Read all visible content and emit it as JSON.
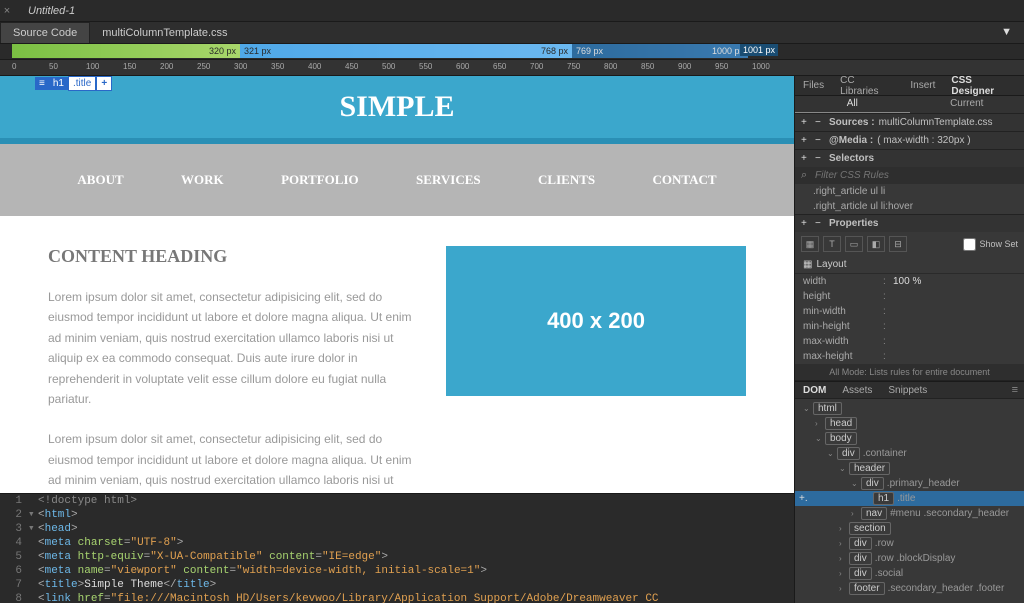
{
  "docTab": "Untitled-1",
  "secondaryTabs": {
    "source": "Source Code",
    "css": "multiColumnTemplate.css"
  },
  "breakpoints": {
    "green": "320  px",
    "blue": {
      "start": "321  px",
      "end": "768  px"
    },
    "darkblue": {
      "start": "769  px",
      "end": "1000  px"
    },
    "scrub": "1001  px"
  },
  "ruler": [
    "0",
    "50",
    "100",
    "150",
    "200",
    "250",
    "300",
    "350",
    "400",
    "450",
    "500",
    "550",
    "600",
    "650",
    "700",
    "750",
    "800",
    "850",
    "900",
    "950",
    "1000"
  ],
  "design": {
    "overlay": {
      "ham": "≡",
      "h1": "h1",
      "title": ".title",
      "plus": "+"
    },
    "title": "SIMPLE",
    "nav": [
      "ABOUT",
      "WORK",
      "PORTFOLIO",
      "SERVICES",
      "CLIENTS",
      "CONTACT"
    ],
    "heading": "CONTENT HEADING",
    "para1": "Lorem ipsum dolor sit amet, consectetur adipisicing elit, sed do eiusmod tempor incididunt ut labore et dolore magna aliqua. Ut enim ad minim veniam, quis nostrud exercitation ullamco laboris nisi ut aliquip ex ea commodo consequat. Duis aute irure dolor in reprehenderit in voluptate velit esse cillum dolore eu fugiat nulla pariatur.",
    "para2": "Lorem ipsum dolor sit amet, consectetur adipisicing elit, sed do eiusmod tempor incididunt ut labore et dolore magna aliqua. Ut enim ad minim veniam, quis nostrud exercitation ullamco laboris nisi ut aliquip ex ea commodo consequat. Duis aute irure dolor in reprehenderit in voluptate velit esse cillum",
    "placeholder": "400 x 200"
  },
  "code": {
    "l1": "<!doctype html>",
    "l2_tag": "html",
    "l3_tag": "head",
    "l4": {
      "tag": "meta",
      "attr": "charset",
      "val": "UTF-8"
    },
    "l5": {
      "tag": "meta",
      "attr1": "http-equiv",
      "val1": "X-UA-Compatible",
      "attr2": "content",
      "val2": "IE=edge"
    },
    "l6": {
      "tag": "meta",
      "attr1": "name",
      "val1": "viewport",
      "attr2": "content",
      "val2": "width=device-width, initial-scale=1"
    },
    "l7": {
      "tag": "title",
      "text": "Simple Theme"
    },
    "l8": {
      "tag": "link",
      "attr": "href",
      "val": "file:///Macintosh HD/Users/kevwoo/Library/Application Support/Adobe/Dreamweaver CC"
    }
  },
  "panelTabs": [
    "Files",
    "CC Libraries",
    "Insert",
    "CSS Designer"
  ],
  "cssSubtabs": {
    "all": "All",
    "current": "Current"
  },
  "cssSections": {
    "sources": {
      "label": "Sources :",
      "val": "multiColumnTemplate.css"
    },
    "media": {
      "label": "@Media :",
      "val": "( max-width : 320px )"
    },
    "selectors": "Selectors",
    "search": "Filter CSS Rules",
    "rules": [
      ".right_article ul li",
      ".right_article ul li:hover"
    ],
    "properties": "Properties",
    "showSet": "Show Set"
  },
  "layout": {
    "header": "Layout",
    "rows": [
      {
        "label": "width",
        "val": "100 %"
      },
      {
        "label": "height",
        "val": ""
      },
      {
        "label": "min-width",
        "val": ""
      },
      {
        "label": "min-height",
        "val": ""
      },
      {
        "label": "max-width",
        "val": ""
      },
      {
        "label": "max-height",
        "val": ""
      }
    ],
    "info": "All Mode: Lists rules for entire document"
  },
  "domTabs": [
    "DOM",
    "Assets",
    "Snippets"
  ],
  "domTree": [
    {
      "indent": 8,
      "arrow": "⌄",
      "tag": "html",
      "cls": ""
    },
    {
      "indent": 20,
      "arrow": "›",
      "tag": "head",
      "cls": ""
    },
    {
      "indent": 20,
      "arrow": "⌄",
      "tag": "body",
      "cls": ""
    },
    {
      "indent": 32,
      "arrow": "⌄",
      "tag": "div",
      "cls": ".container"
    },
    {
      "indent": 44,
      "arrow": "⌄",
      "tag": "header",
      "cls": ""
    },
    {
      "indent": 56,
      "arrow": "⌄",
      "tag": "div",
      "cls": ".primary_header"
    },
    {
      "indent": 68,
      "arrow": "",
      "tag": "h1",
      "cls": ".title",
      "selected": true
    },
    {
      "indent": 56,
      "arrow": "›",
      "tag": "nav",
      "cls": "#menu .secondary_header"
    },
    {
      "indent": 44,
      "arrow": "›",
      "tag": "section",
      "cls": ""
    },
    {
      "indent": 44,
      "arrow": "›",
      "tag": "div",
      "cls": ".row"
    },
    {
      "indent": 44,
      "arrow": "›",
      "tag": "div",
      "cls": ".row .blockDisplay"
    },
    {
      "indent": 44,
      "arrow": "›",
      "tag": "div",
      "cls": ".social"
    },
    {
      "indent": 44,
      "arrow": "›",
      "tag": "footer",
      "cls": ".secondary_header .footer"
    }
  ]
}
